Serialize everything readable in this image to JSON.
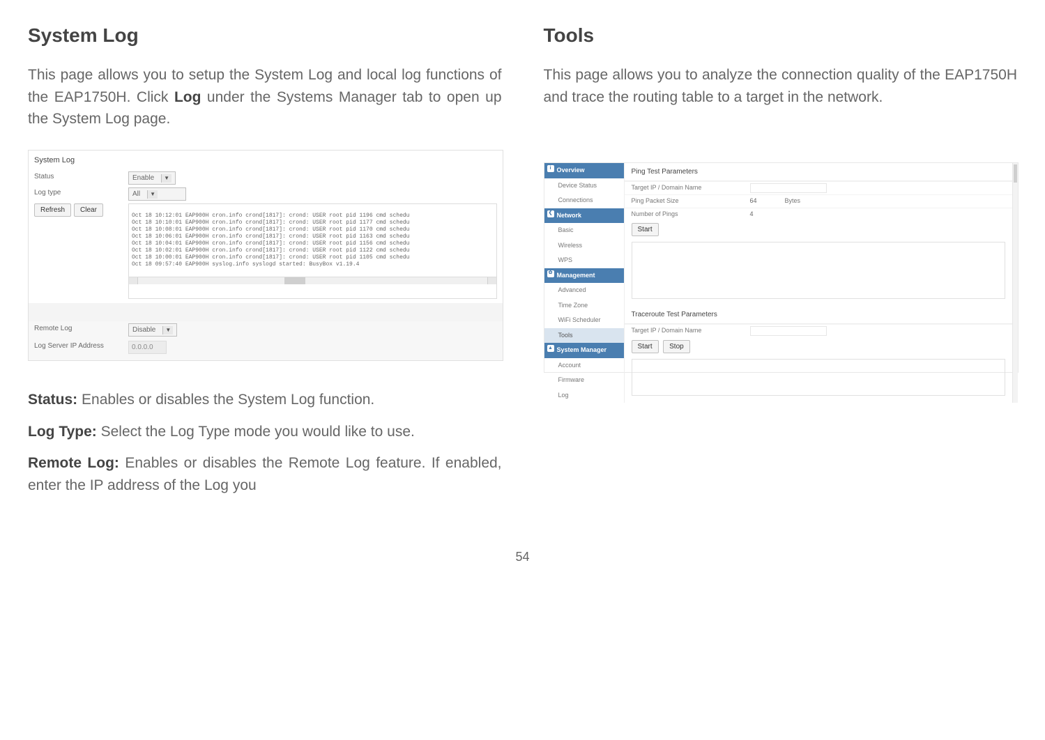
{
  "left": {
    "title": "System Log",
    "intro_pre": "This page allows you to setup the System Log and local log functions of the EAP1750H. Click ",
    "intro_bold": "Log",
    "intro_post": " under the Systems Manager tab to open up the System Log page.",
    "panel": {
      "title": "System Log",
      "status_label": "Status",
      "status_value": "Enable",
      "logtype_label": "Log type",
      "logtype_value": "All",
      "refresh": "Refresh",
      "clear": "Clear",
      "log_lines": "Oct 18 10:12:01 EAP900H cron.info crond[1817]: crond: USER root pid 1196 cmd schedu\nOct 18 10:10:01 EAP900H cron.info crond[1817]: crond: USER root pid 1177 cmd schedu\nOct 18 10:08:01 EAP900H cron.info crond[1817]: crond: USER root pid 1170 cmd schedu\nOct 18 10:06:01 EAP900H cron.info crond[1817]: crond: USER root pid 1163 cmd schedu\nOct 18 10:04:01 EAP900H cron.info crond[1817]: crond: USER root pid 1156 cmd schedu\nOct 18 10:02:01 EAP900H cron.info crond[1817]: crond: USER root pid 1122 cmd schedu\nOct 18 10:00:01 EAP900H cron.info crond[1817]: crond: USER root pid 1105 cmd schedu\nOct 18 09:57:40 EAP900H syslog.info syslogd started: BusyBox v1.19.4",
      "remote_label": "Remote Log",
      "remote_value": "Disable",
      "ip_label": "Log Server IP Address",
      "ip_value": "0.0.0.0"
    },
    "defs": {
      "status_term": "Status:",
      "status_text": " Enables or disables the System Log function.",
      "logtype_term": "Log Type:",
      "logtype_text": " Select the Log Type mode you would like to use.",
      "remote_term": "Remote Log:",
      "remote_text": " Enables or disables the Remote Log feature. If enabled, enter the IP address of the Log you"
    }
  },
  "right": {
    "title": "Tools",
    "intro": "This page allows you to analyze the connection quality of the EAP1750H and trace the routing table to a target in the network.",
    "sidebar": {
      "overview": "Overview",
      "device_status": "Device Status",
      "connections": "Connections",
      "network": "Network",
      "basic": "Basic",
      "wireless": "Wireless",
      "wps": "WPS",
      "management": "Management",
      "advanced": "Advanced",
      "time_zone": "Time Zone",
      "wifi_scheduler": "WiFi Scheduler",
      "tools": "Tools",
      "system_manager": "System Manager",
      "account": "Account",
      "firmware": "Firmware",
      "log": "Log"
    },
    "ping": {
      "title": "Ping Test Parameters",
      "target_label": "Target IP / Domain Name",
      "size_label": "Ping Packet Size",
      "size_value": "64",
      "size_unit": "Bytes",
      "count_label": "Number of Pings",
      "count_value": "4",
      "start": "Start"
    },
    "trace": {
      "title": "Traceroute Test Parameters",
      "target_label": "Target IP / Domain Name",
      "start": "Start",
      "stop": "Stop"
    }
  },
  "page_number": "54"
}
